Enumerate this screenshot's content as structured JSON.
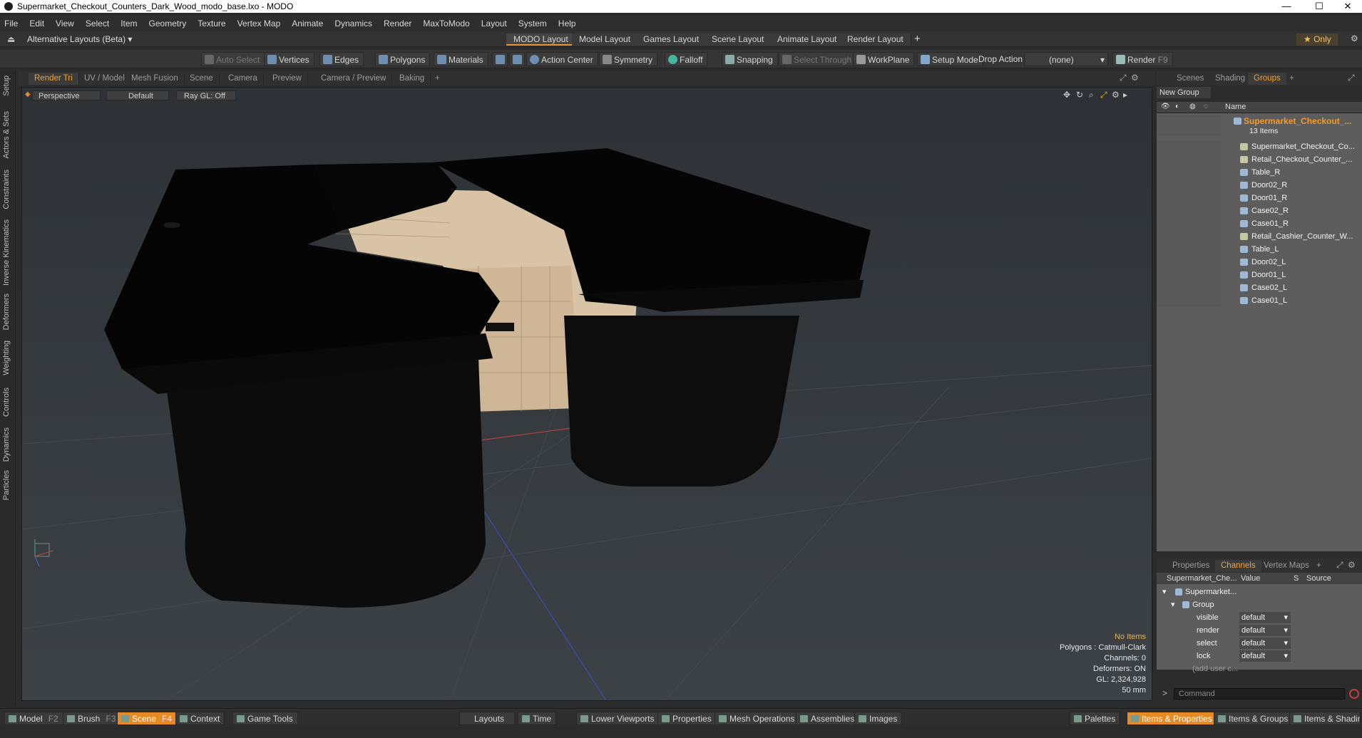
{
  "window": {
    "title": "Supermarket_Checkout_Counters_Dark_Wood_modo_base.lxo - MODO",
    "controls": [
      "—",
      "☐",
      "✕"
    ]
  },
  "menu": [
    "File",
    "Edit",
    "View",
    "Select",
    "Item",
    "Geometry",
    "Texture",
    "Vertex Map",
    "Animate",
    "Dynamics",
    "Render",
    "MaxToModo",
    "Layout",
    "System",
    "Help"
  ],
  "layouts": {
    "alt_label": "Alternative Layouts (Beta) ▾",
    "tabs": [
      "MODO Layout",
      "Model Layout",
      "Games Layout",
      "Scene Layout",
      "Animate Layout",
      "Render Layout"
    ],
    "active": "MODO Layout",
    "add": "+",
    "only": "★ Only"
  },
  "toolbar": {
    "auto_select": "Auto Select",
    "vertices": "Vertices",
    "edges": "Edges",
    "polygons": "Polygons",
    "materials": "Materials",
    "action_center": "Action Center",
    "symmetry": "Symmetry",
    "falloff": "Falloff",
    "snapping": "Snapping",
    "select_through": "Select Through",
    "workplane": "WorkPlane",
    "setup_mode": "Setup Mode",
    "drop_action": "Drop Action",
    "drop_value": "(none)",
    "render": "Render",
    "render_key": "F9"
  },
  "left_tabs": [
    "Setup",
    "Actors & Sets",
    "Constraints",
    "Inverse Kinematics",
    "Deformers",
    "Weighting",
    "Controls",
    "Dynamics",
    "Particles"
  ],
  "viewport_tabs": [
    "Render Tri",
    "UV / Model",
    "Mesh Fusion",
    "Scene",
    "Camera",
    "Preview",
    "Camera / Preview",
    "Baking",
    "+"
  ],
  "viewport_header": {
    "view": "Perspective",
    "shading": "Default",
    "raygl": "Ray GL: Off"
  },
  "viewport_info": {
    "selection": "No Items",
    "polygons": "Polygons : Catmull-Clark",
    "channels": "Channels: 0",
    "deformers": "Deformers: ON",
    "gl": "GL: 2,324,928",
    "unit": "50 mm"
  },
  "right_tabs": [
    "Scenes",
    "Shading",
    "Groups",
    "+"
  ],
  "groups": {
    "new_group": "New Group",
    "name_col": "Name",
    "group_name": "Supermarket_Checkout_...",
    "count": "13 Items",
    "items": [
      "Supermarket_Checkout_Co...",
      "Retail_Checkout_Counter_...",
      "Table_R",
      "Door02_R",
      "Door01_R",
      "Case02_R",
      "Case01_R",
      "Retail_Cashier_Counter_W...",
      "Table_L",
      "Door02_L",
      "Door01_L",
      "Case02_L",
      "Case01_L"
    ]
  },
  "channel_tabs": [
    "Properties",
    "Channels",
    "Vertex Maps",
    "+"
  ],
  "channels": {
    "col_name": "Supermarket_Che...",
    "col_value": "Value",
    "col_s": "S",
    "col_source": "Source",
    "root": "Supermarket...",
    "group": "Group",
    "rows": [
      {
        "name": "visible",
        "value": "default"
      },
      {
        "name": "render",
        "value": "default"
      },
      {
        "name": "select",
        "value": "default"
      },
      {
        "name": "lock",
        "value": "default"
      }
    ],
    "add": "(add user c..."
  },
  "command": {
    "prompt": ">",
    "placeholder": "Command"
  },
  "bottom": {
    "model": "Model",
    "model_key": "F2",
    "brush": "Brush",
    "brush_key": "F3",
    "scene": "Scene",
    "scene_key": "F4",
    "context": "Context",
    "game_tools": "Game Tools",
    "layouts": "Layouts",
    "time": "Time",
    "lower_viewports": "Lower Viewports",
    "properties": "Properties",
    "mesh_operations": "Mesh Operations",
    "assemblies": "Assemblies",
    "images": "Images",
    "palettes": "Palettes",
    "items_properties": "Items & Properties",
    "items_groups": "Items & Groups",
    "items_shading": "Items & Shading"
  }
}
